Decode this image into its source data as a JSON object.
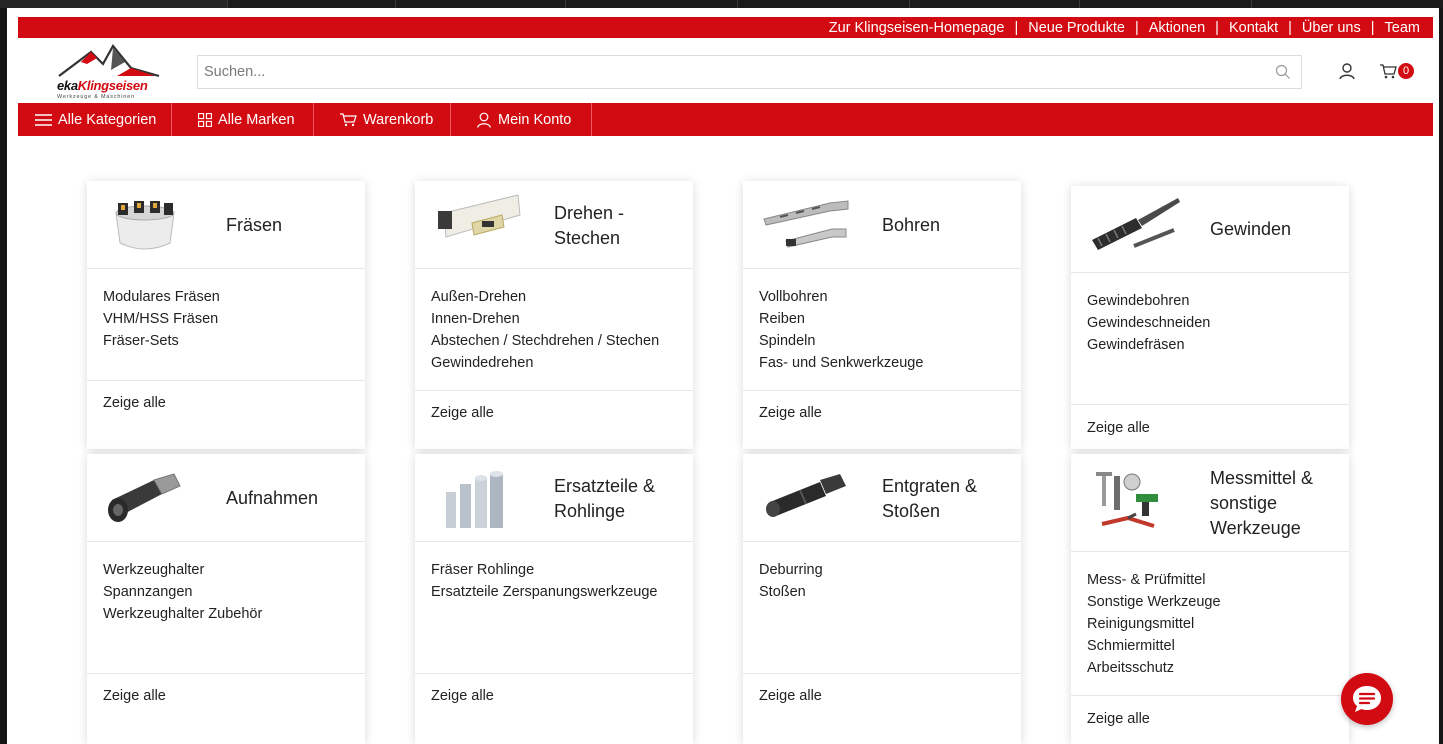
{
  "top_links": [
    "Zur Klingseisen-Homepage",
    "Neue Produkte",
    "Aktionen",
    "Kontakt",
    "Über uns",
    "Team"
  ],
  "logo": {
    "part1": "eka",
    "part2": "Klingseisen",
    "tagline": "Werkzeuge & Maschinen"
  },
  "search": {
    "placeholder": "Suchen..."
  },
  "cart": {
    "count": "0"
  },
  "nav": {
    "categories": "Alle Kategorien",
    "brands": "Alle Marken",
    "cart": "Warenkorb",
    "account": "Mein Konto"
  },
  "cards": [
    {
      "title": "Fräsen",
      "links": [
        "Modulares Fräsen",
        "VHM/HSS Fräsen",
        "Fräser-Sets"
      ],
      "more": "Zeige alle"
    },
    {
      "title": "Drehen - Stechen",
      "links": [
        "Außen-Drehen",
        "Innen-Drehen",
        "Abstechen / Stechdrehen / Stechen",
        "Gewindedrehen"
      ],
      "more": "Zeige alle"
    },
    {
      "title": "Bohren",
      "links": [
        "Vollbohren",
        "Reiben",
        "Spindeln",
        "Fas- und Senkwerkzeuge"
      ],
      "more": "Zeige alle"
    },
    {
      "title": "Gewinden",
      "links": [
        "Gewindebohren",
        "Gewindeschneiden",
        "Gewindefräsen"
      ],
      "more": "Zeige alle"
    },
    {
      "title": "Aufnahmen",
      "links": [
        "Werkzeughalter",
        "Spannzangen",
        "Werkzeughalter Zubehör"
      ],
      "more": "Zeige alle"
    },
    {
      "title": "Ersatzteile & Rohlinge",
      "links": [
        "Fräser Rohlinge",
        "Ersatzteile Zerspanungswerkzeuge"
      ],
      "more": "Zeige alle"
    },
    {
      "title": "Entgraten & Stoßen",
      "links": [
        "Deburring",
        "Stoßen"
      ],
      "more": "Zeige alle"
    },
    {
      "title": "Messmittel & sonstige Werkzeuge",
      "links": [
        "Mess- & Prüfmittel",
        "Sonstige Werkzeuge",
        "Reinigungsmittel",
        "Schmiermittel",
        "Arbeitsschutz"
      ],
      "more": "Zeige alle"
    }
  ],
  "colors": {
    "brand_red": "#d20a11",
    "text": "#222222",
    "card_border": "#e6e6e6"
  }
}
